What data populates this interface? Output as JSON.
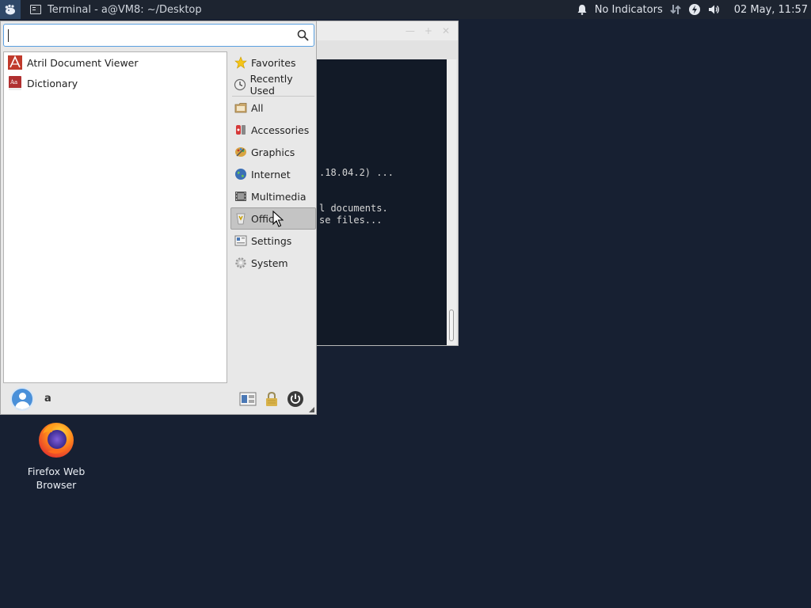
{
  "panel": {
    "task_title": "Terminal - a@VM8: ~/Desktop",
    "indicators_label": "No Indicators",
    "clock": "02 May, 11:57"
  },
  "terminal": {
    "lines": [
      ".18.04.2) ...",
      "l documents.",
      "se files..."
    ]
  },
  "menu": {
    "search": {
      "value": "",
      "placeholder": ""
    },
    "apps": [
      {
        "label": "Atril Document Viewer",
        "icon": "atril-icon"
      },
      {
        "label": "Dictionary",
        "icon": "dictionary-icon"
      }
    ],
    "categories": [
      {
        "label": "Favorites",
        "icon": "star-icon"
      },
      {
        "label": "Recently Used",
        "icon": "clock-icon"
      },
      {
        "label": "All",
        "icon": "folder-icon"
      },
      {
        "label": "Accessories",
        "icon": "accessories-icon"
      },
      {
        "label": "Graphics",
        "icon": "palette-icon"
      },
      {
        "label": "Internet",
        "icon": "globe-icon"
      },
      {
        "label": "Multimedia",
        "icon": "film-icon"
      },
      {
        "label": "Office",
        "icon": "office-icon",
        "selected": true
      },
      {
        "label": "Settings",
        "icon": "settings-icon"
      },
      {
        "label": "System",
        "icon": "gear-icon"
      }
    ],
    "user": {
      "name": "a"
    }
  },
  "desktop": {
    "icons": [
      {
        "label_line1": "Firefox Web",
        "label_line2": "Browser",
        "icon": "firefox-icon"
      }
    ]
  },
  "colors": {
    "desktop_bg": "#172032",
    "panel_bg": "#1d2430",
    "selection_bg": "#c4c4c4",
    "search_focus": "#5aa0e0"
  }
}
